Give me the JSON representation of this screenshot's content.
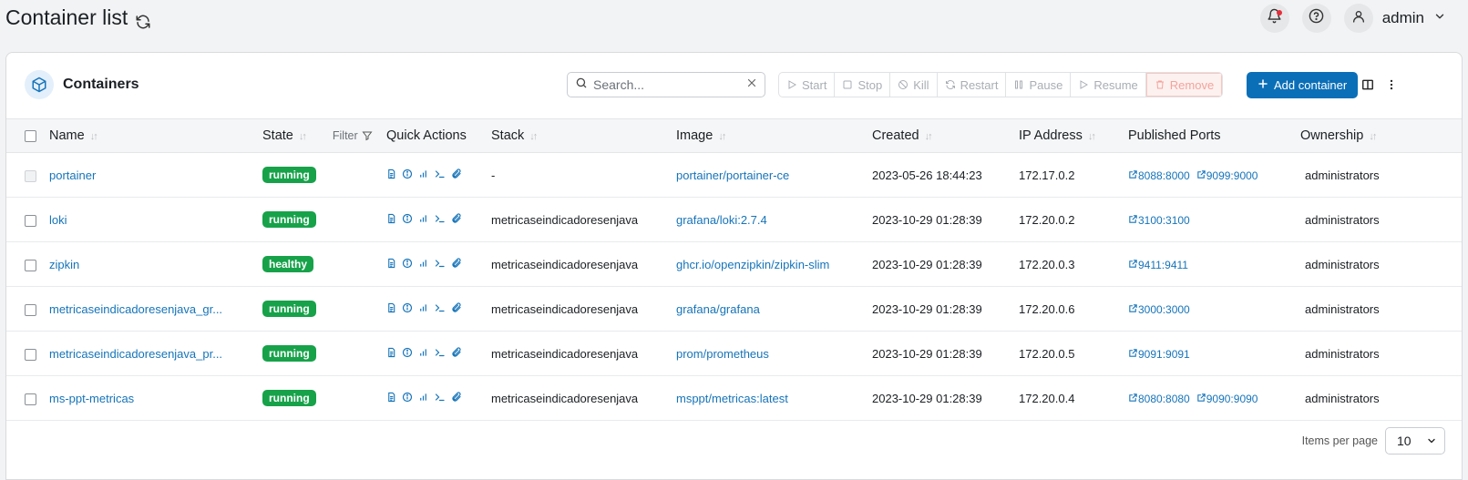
{
  "header": {
    "title": "Container list",
    "username": "admin"
  },
  "card": {
    "title": "Containers",
    "search_placeholder": "Search...",
    "actions": [
      "Start",
      "Stop",
      "Kill",
      "Restart",
      "Pause",
      "Resume",
      "Remove"
    ],
    "add_label": "Add container"
  },
  "table": {
    "columns": {
      "name": "Name",
      "state": "State",
      "filter": "Filter",
      "quick_actions": "Quick Actions",
      "stack": "Stack",
      "image": "Image",
      "created": "Created",
      "ip": "IP Address",
      "ports": "Published Ports",
      "ownership": "Ownership"
    },
    "rows": [
      {
        "name": "portainer",
        "state": "running",
        "stack": "-",
        "image": "portainer/portainer-ce",
        "created": "2023-05-26 18:44:23",
        "ip": "172.17.0.2",
        "ports": [
          "8088:8000",
          "9099:9000"
        ],
        "ownership": "administrators"
      },
      {
        "name": "loki",
        "state": "running",
        "stack": "metricaseindicadoresenjava",
        "image": "grafana/loki:2.7.4",
        "created": "2023-10-29 01:28:39",
        "ip": "172.20.0.2",
        "ports": [
          "3100:3100"
        ],
        "ownership": "administrators"
      },
      {
        "name": "zipkin",
        "state": "healthy",
        "stack": "metricaseindicadoresenjava",
        "image": "ghcr.io/openzipkin/zipkin-slim",
        "created": "2023-10-29 01:28:39",
        "ip": "172.20.0.3",
        "ports": [
          "9411:9411"
        ],
        "ownership": "administrators"
      },
      {
        "name": "metricaseindicadoresenjava_gr...",
        "state": "running",
        "stack": "metricaseindicadoresenjava",
        "image": "grafana/grafana",
        "created": "2023-10-29 01:28:39",
        "ip": "172.20.0.6",
        "ports": [
          "3000:3000"
        ],
        "ownership": "administrators"
      },
      {
        "name": "metricaseindicadoresenjava_pr...",
        "state": "running",
        "stack": "metricaseindicadoresenjava",
        "image": "prom/prometheus",
        "created": "2023-10-29 01:28:39",
        "ip": "172.20.0.5",
        "ports": [
          "9091:9091"
        ],
        "ownership": "administrators"
      },
      {
        "name": "ms-ppt-metricas",
        "state": "running",
        "stack": "metricaseindicadoresenjava",
        "image": "msppt/metricas:latest",
        "created": "2023-10-29 01:28:39",
        "ip": "172.20.0.4",
        "ports": [
          "8080:8080",
          "9090:9090"
        ],
        "ownership": "administrators"
      }
    ]
  },
  "footer": {
    "items_per_page_label": "Items per page",
    "items_per_page": "10"
  },
  "colors": {
    "primary": "#0b6fb8",
    "link": "#1674b9",
    "status_green": "#17a24a",
    "notification_dot": "#e5303c"
  },
  "icons": {
    "refresh": "refresh-icon",
    "bell": "bell-icon",
    "help": "help-icon",
    "user": "user-icon",
    "cube": "cube-icon"
  }
}
